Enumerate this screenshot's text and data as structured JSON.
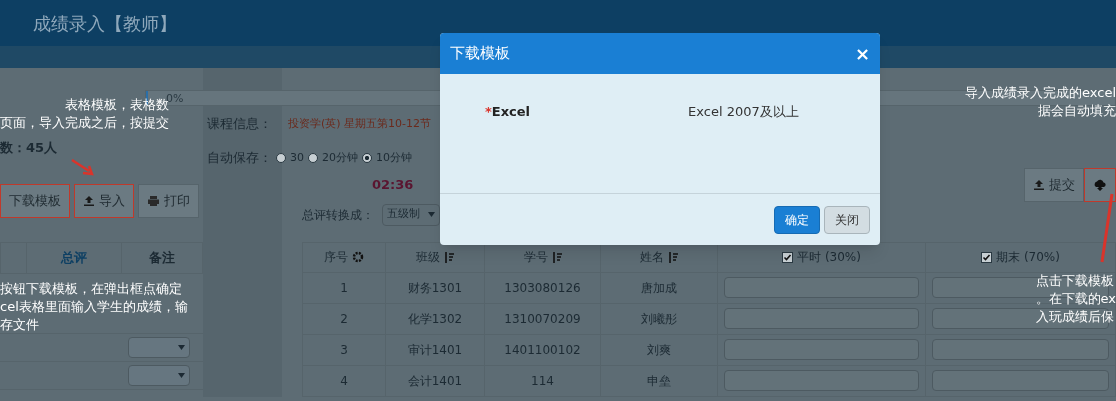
{
  "header": {
    "title": "成绩录入【教师】"
  },
  "progress": {
    "label": "0%",
    "level": 0
  },
  "left_panel": {
    "total": "数：45人",
    "buttons": [
      {
        "label": "下载模板",
        "highlighted": true
      },
      {
        "label": "导入",
        "highlighted": true
      },
      {
        "label": "打印",
        "highlighted": false
      }
    ],
    "columns": [
      "总评",
      "备注"
    ]
  },
  "course": {
    "label": "课程信息：",
    "value": "投资学(英) 星期五第10-12节"
  },
  "autosave": {
    "label": "自动保存：",
    "options": [
      {
        "label": "30",
        "selected": false
      },
      {
        "label": "20分钟",
        "selected": false
      },
      {
        "label": "10分钟",
        "selected": true
      }
    ]
  },
  "timer": "02:36",
  "convert": {
    "label": "总评转换成：",
    "value": "五级制"
  },
  "actions": [
    {
      "label": "提交",
      "highlighted": false
    },
    {
      "highlighted": true
    }
  ],
  "table": {
    "columns": [
      {
        "label": "序号",
        "kind": "gear"
      },
      {
        "label": "班级",
        "kind": "sort"
      },
      {
        "label": "学号",
        "kind": "sort"
      },
      {
        "label": "姓名",
        "kind": "sort"
      },
      {
        "label": "平时 (30%)",
        "kind": "check",
        "checked": true
      },
      {
        "label": "期末 (70%)",
        "kind": "check",
        "checked": true
      }
    ],
    "rows": [
      {
        "no": "1",
        "class": "财务1301",
        "id": "1303080126",
        "name": "唐加成"
      },
      {
        "no": "2",
        "class": "化学1302",
        "id": "1310070209",
        "name": "刘曦彤"
      },
      {
        "no": "3",
        "class": "审计1401",
        "id": "1401100102",
        "name": "刘爽"
      },
      {
        "no": "4",
        "class": "会计1401",
        "id": "114",
        "name": "申垒"
      }
    ]
  },
  "modal": {
    "title": "下载模板",
    "close": "×",
    "required_mark": "*",
    "field_label": "Excel",
    "field_value": "Excel 2007及以上",
    "buttons": [
      {
        "label": "确定",
        "kind": "primary"
      },
      {
        "label": "关闭",
        "kind": "default"
      }
    ]
  },
  "annotations": [
    {
      "lines": [
        "表格模板，表格数",
        "页面，导入完成之后，按提交"
      ]
    },
    {
      "lines": [
        "按钮下载模板，在弹出框点确定",
        "cel表格里面输入学生的成绩，输",
        "存文件"
      ]
    },
    {
      "lines": [
        "导入成绩录入完成的excel",
        "据会自动填充"
      ]
    },
    {
      "lines": [
        "点击下载模板",
        "。在下载的ex",
        "入玩成绩后保"
      ]
    }
  ]
}
